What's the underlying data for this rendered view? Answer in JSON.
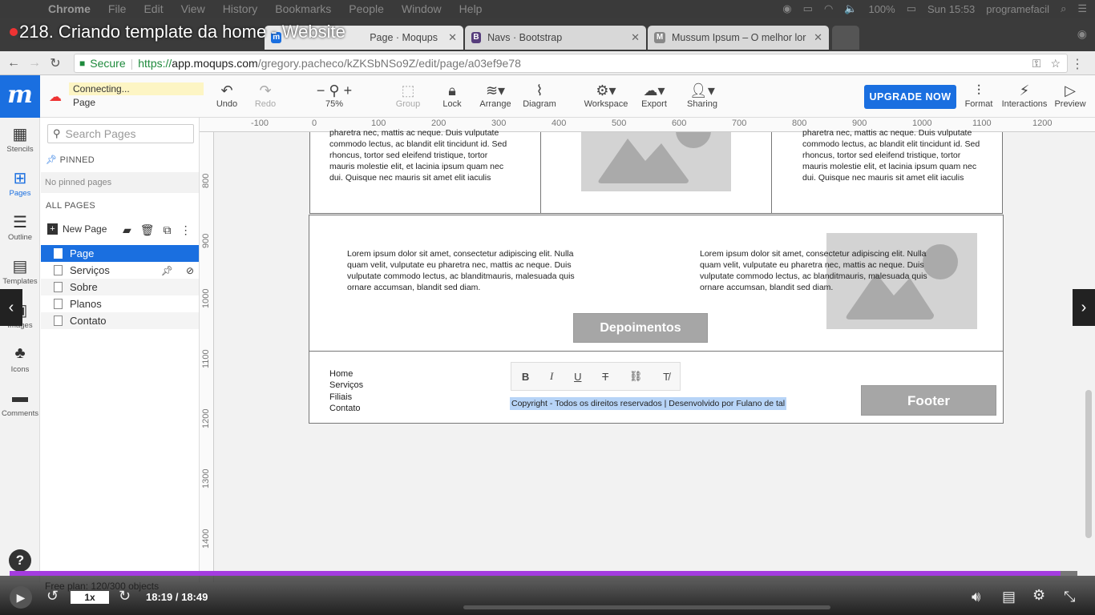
{
  "menubar": {
    "app": "Chrome",
    "items": [
      "File",
      "Edit",
      "View",
      "History",
      "Bookmarks",
      "People",
      "Window",
      "Help"
    ],
    "battery": "100%",
    "clock": "Sun 15:53",
    "user": "programefacil"
  },
  "video_title": "218. Criando template da home - Website",
  "tabs": [
    {
      "title": "Page · Moqups",
      "fav": "m",
      "color": "#1a6fe0"
    },
    {
      "title": "Navs · Bootstrap",
      "fav": "B",
      "color": "#563d7c"
    },
    {
      "title": "Mussum Ipsum – O melhor lor",
      "fav": "M",
      "color": "#888"
    }
  ],
  "address": {
    "secure": "Secure",
    "scheme": "https://",
    "host": "app.moqups.com",
    "path": "/gregory.pacheco/kZKSbNSo9Z/edit/page/a03ef9e78"
  },
  "toolbar": {
    "status": "Connecting...",
    "page_name": "Page",
    "zoom": "75%",
    "upgrade": "UPGRADE NOW",
    "buttons": {
      "undo": "Undo",
      "redo": "Redo",
      "group": "Group",
      "lock": "Lock",
      "arrange": "Arrange",
      "diagram": "Diagram",
      "workspace": "Workspace",
      "export": "Export",
      "sharing": "Sharing",
      "format": "Format",
      "interactions": "Interactions",
      "preview": "Preview"
    }
  },
  "rail": [
    "Stencils",
    "Pages",
    "Outline",
    "Templates",
    "Images",
    "Icons",
    "Comments"
  ],
  "panel": {
    "search_placeholder": "Search Pages",
    "pinned_header": "PINNED",
    "pinned_empty": "No pinned pages",
    "all_header": "ALL PAGES",
    "new_page": "New Page",
    "pages": [
      "Page",
      "Serviços",
      "Sobre",
      "Planos",
      "Contato"
    ]
  },
  "ruler": {
    "h": [
      "-100",
      "0",
      "100",
      "200",
      "300",
      "400",
      "500",
      "600",
      "700",
      "800",
      "900",
      "1000",
      "1100",
      "1200"
    ],
    "v": [
      "800",
      "900",
      "1000",
      "1100",
      "1200",
      "1300",
      "1400"
    ]
  },
  "canvas": {
    "lorem_top_left": "pharetra nec, mattis ac neque. Duis vulputate commodo lectus, ac blandit elit tincidunt id. Sed rhoncus, tortor sed eleifend tristique, tortor mauris molestie elit, et lacinia ipsum quam nec dui. Quisque nec mauris sit amet elit iaculis",
    "lorem_top_right": "pharetra nec, mattis ac neque. Duis vulputate commodo lectus, ac blandit elit tincidunt id. Sed rhoncus, tortor sed eleifend tristique, tortor mauris molestie elit, et lacinia ipsum quam nec dui. Quisque nec mauris sit amet elit iaculis",
    "lorem_mid": "Lorem ipsum dolor sit amet, consectetur adipiscing elit. Nulla quam velit, vulputate eu pharetra nec, mattis ac neque. Duis vulputate commodo lectus, ac blanditmauris, malesuada quis ornare accumsan, blandit sed diam.",
    "depoimentos": "Depoimentos",
    "footer_links": [
      "Home",
      "Serviços",
      "Filiais",
      "Contato"
    ],
    "copyright": "Copyright - Todos os direitos reservados | Desenvolvido por Fulano de tal",
    "footer_btn": "Footer"
  },
  "player": {
    "free_plan": "Free plan: 120/300 objects",
    "speed": "1x",
    "time": "18:19 / 18:49",
    "progress": 0.984
  }
}
